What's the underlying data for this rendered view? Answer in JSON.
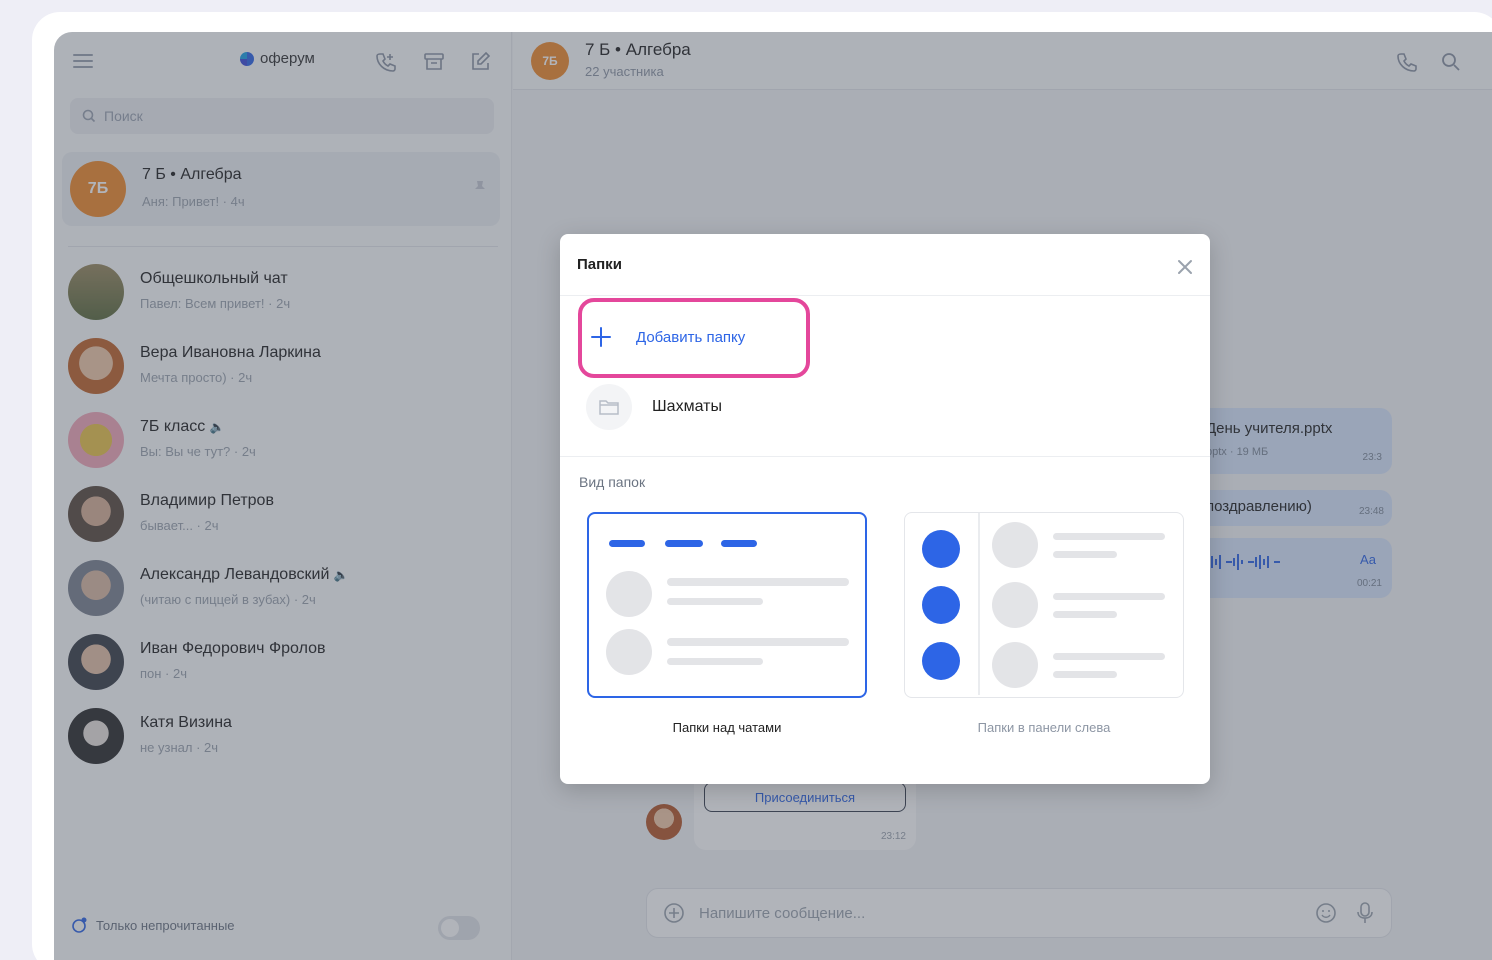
{
  "sidebar": {
    "logo": "оферум",
    "search_placeholder": "Поиск",
    "active_chat": {
      "initials": "7Б",
      "name": "7 Б • Алгебра",
      "preview": "Аня: Привет! · 4ч"
    },
    "chats": [
      {
        "name": "Общешкольный чат",
        "preview": "Павел: Всем привет! · 2ч"
      },
      {
        "name": "Вера Ивановна Ларкина",
        "preview": "Мечта просто) · 2ч"
      },
      {
        "name": "7Б класс",
        "preview": "Вы: Вы че тут? · 2ч"
      },
      {
        "name": "Владимир Петров",
        "preview": "бывает... · 2ч"
      },
      {
        "name": "Александр Левандовский",
        "preview": "(читаю с пиццей в зубах) · 2ч"
      },
      {
        "name": "Иван Федорович Фролов",
        "preview": "пон · 2ч"
      },
      {
        "name": "Катя Визина",
        "preview": "не узнал · 2ч"
      }
    ],
    "unread_only": "Только непрочитанные"
  },
  "conversation": {
    "avatar_initials": "7Б",
    "title": "7 Б • Алгебра",
    "subtitle": "22 участника",
    "file_name": "День учителя.pptx",
    "file_meta": "pptx · 19 МБ",
    "file_time": "23:3",
    "msg_text": "поздравлению)",
    "msg_time": "23:48",
    "voice_speed": "Аа",
    "voice_time": "00:21",
    "join_button": "Присоединиться",
    "join_time": "23:12",
    "composer_placeholder": "Напишите сообщение..."
  },
  "modal": {
    "title": "Папки",
    "add_folder": "Добавить папку",
    "folders": [
      "Шахматы"
    ],
    "view_label": "Вид папок",
    "option_top": "Папки над чатами",
    "option_left": "Папки в панели слева",
    "selected_option": "Папки над чатами"
  },
  "colors": {
    "accent": "#2d65e6",
    "highlight": "#e4479b",
    "avatar_orange": "#f08a2c"
  }
}
